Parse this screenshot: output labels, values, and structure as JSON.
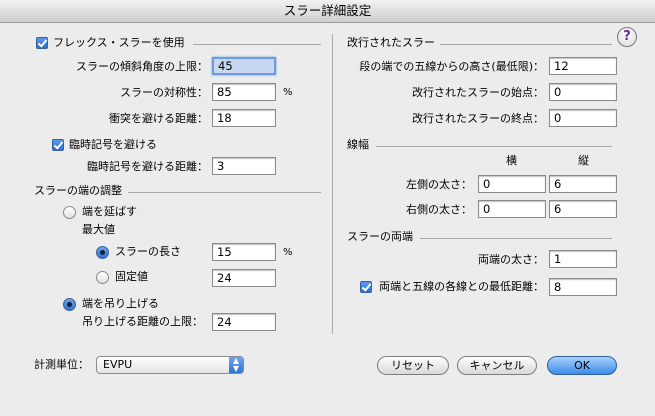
{
  "window": {
    "title": "スラー詳細設定"
  },
  "flex": {
    "checkbox_label": "フレックス・スラーを使用",
    "max_angle_label": "スラーの傾斜角度の上限：",
    "max_angle_value": "45",
    "symmetry_label": "スラーの対称性：",
    "symmetry_value": "85",
    "symmetry_unit": "%",
    "collision_label": "衝突を避ける距離：",
    "collision_value": "18"
  },
  "accidentals": {
    "checkbox_label": "臨時記号を避ける",
    "distance_label": "臨時記号を避ける距離：",
    "distance_value": "3"
  },
  "endpoint": {
    "section_title": "スラーの端の調整",
    "extend_label": "端を延ばす",
    "max_label": "最大値",
    "length_label": "スラーの長さ",
    "length_value": "15",
    "length_unit": "%",
    "fixed_label": "固定値",
    "fixed_value": "24",
    "raise_label": "端を吊り上げる",
    "raise_limit_label": "吊り上げる距離の上限：",
    "raise_limit_value": "24"
  },
  "units": {
    "label": "計測単位：",
    "value": "EVPU"
  },
  "broken": {
    "section_title": "改行されたスラー",
    "height_label": "段の端での五線からの高さ(最低限)：",
    "height_value": "12",
    "start_label": "改行されたスラーの始点：",
    "start_value": "0",
    "end_label": "改行されたスラーの終点：",
    "end_value": "0"
  },
  "thickness": {
    "section_title": "線幅",
    "col_h": "横",
    "col_v": "縦",
    "left_label": "左側の太さ：",
    "left_h": "0",
    "left_v": "6",
    "right_label": "右側の太さ：",
    "right_h": "0",
    "right_v": "6"
  },
  "ends": {
    "section_title": "スラーの両端",
    "thickness_label": "両端の太さ：",
    "thickness_value": "1",
    "min_dist_label": "両端と五線の各線との最低距離：",
    "min_dist_value": "8"
  },
  "buttons": {
    "reset": "リセット",
    "cancel": "キャンセル",
    "ok": "OK",
    "help": "?"
  }
}
